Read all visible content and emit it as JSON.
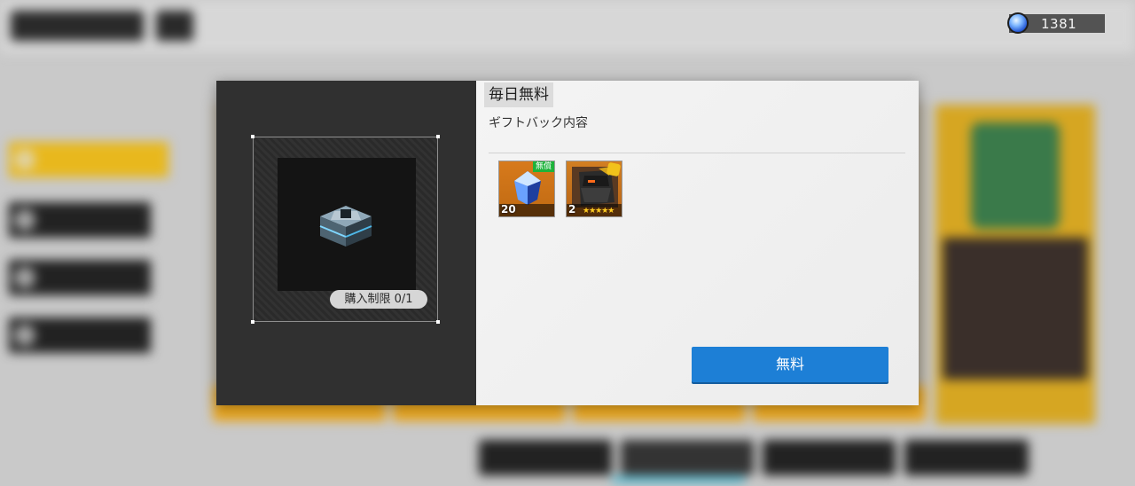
{
  "currency": {
    "icon": "gem-icon",
    "amount": "1381"
  },
  "left_panel": {
    "purchase_limit": "購入制限 0/1"
  },
  "right_panel": {
    "title": "毎日無料",
    "subtitle": "ギフトバック内容",
    "items": [
      {
        "icon": "crystal-icon",
        "count": "20",
        "badge": "無償",
        "rarity_color": "#d77a1c"
      },
      {
        "icon": "hero-portrait-icon",
        "count": "2",
        "stars": "★★★★★",
        "rarity_color": "#d27f22"
      }
    ],
    "claim_button": "無料"
  },
  "colors": {
    "accent_button": "#1d7fd6",
    "free_badge": "#1db33a",
    "dark_panel": "#303030",
    "light_panel": "#f0f0f0"
  }
}
